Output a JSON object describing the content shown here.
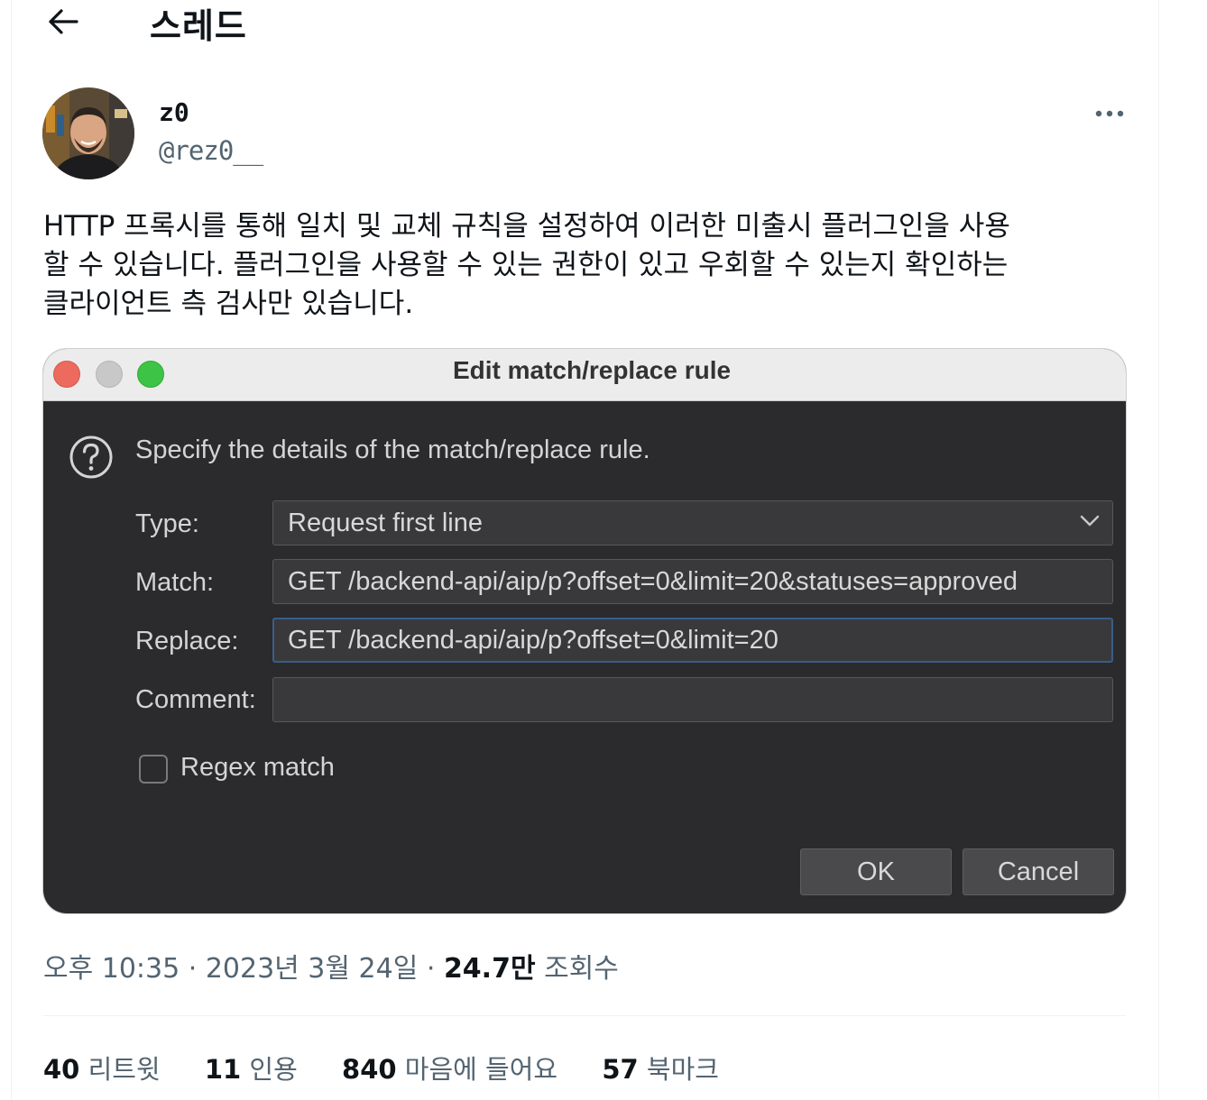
{
  "header": {
    "title": "스레드"
  },
  "author": {
    "name": "z0",
    "handle": "@rez0__"
  },
  "tweet": {
    "text_lines": [
      "HTTP 프록시를 통해 일치 및 교체 규칙을 설정하여 이러한 미출시 플러그인을 사용",
      "할 수 있습니다. 플러그인을 사용할 수 있는 권한이 있고 우회할 수 있는지 확인하는",
      "클라이언트 측 검사만 있습니다."
    ]
  },
  "dialog": {
    "title": "Edit match/replace rule",
    "description": "Specify the details of the match/replace rule.",
    "type_label": "Type:",
    "type_value": "Request first line",
    "match_label": "Match:",
    "match_value": "GET /backend-api/aip/p?offset=0&limit=20&statuses=approved",
    "replace_label": "Replace:",
    "replace_value": "GET /backend-api/aip/p?offset=0&limit=20",
    "comment_label": "Comment:",
    "comment_value": "",
    "regex_label": "Regex match",
    "ok_label": "OK",
    "cancel_label": "Cancel"
  },
  "meta": {
    "time": "오후 10:35",
    "date": "2023년 3월 24일",
    "views_count": "24.7만",
    "views_label": "조회수"
  },
  "stats": {
    "retweets": {
      "count": "40",
      "label": "리트윗"
    },
    "quotes": {
      "count": "11",
      "label": "인용"
    },
    "likes": {
      "count": "840",
      "label": "마음에 들어요"
    },
    "bookmarks": {
      "count": "57",
      "label": "북마크"
    }
  },
  "icons": {
    "back": "arrow-left-icon",
    "more": "more-horizontal-icon",
    "help": "question-circle-icon",
    "dropdown": "chevron-down-icon"
  }
}
